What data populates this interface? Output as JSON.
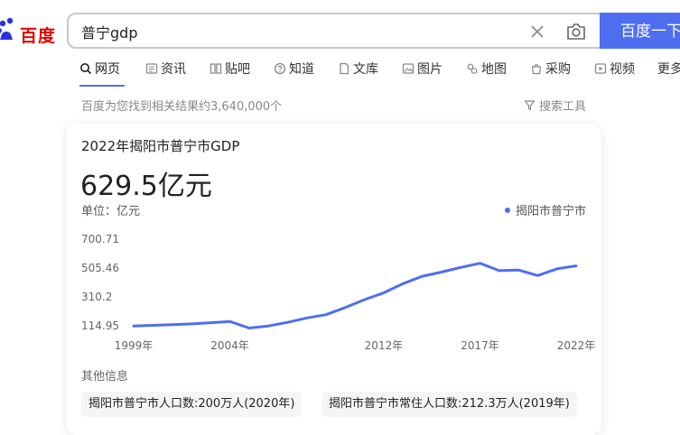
{
  "logo": {
    "text": "百度"
  },
  "search": {
    "query": "普宁gdp",
    "button_label": "百度一下"
  },
  "tabs": [
    {
      "label": "网页",
      "icon": "search-icon",
      "active": true
    },
    {
      "label": "资讯",
      "icon": "news-icon"
    },
    {
      "label": "贴吧",
      "icon": "tieba-icon"
    },
    {
      "label": "知道",
      "icon": "question-icon"
    },
    {
      "label": "文库",
      "icon": "document-icon"
    },
    {
      "label": "图片",
      "icon": "image-icon"
    },
    {
      "label": "地图",
      "icon": "map-icon"
    },
    {
      "label": "采购",
      "icon": "purchase-icon"
    },
    {
      "label": "视频",
      "icon": "video-icon"
    },
    {
      "label": "更多",
      "icon": ""
    }
  ],
  "result_count": "百度为您找到相关结果约3,640,000个",
  "tools_label": "搜索工具",
  "card": {
    "title": "2022年揭阳市普宁市GDP",
    "value": "629.5亿元",
    "unit": "单位：亿元",
    "other_label": "其他信息",
    "chips": [
      "揭阳市普宁市人口数:200万人(2020年)",
      "揭阳市普宁市常住人口数:212.3万人(2019年)"
    ]
  },
  "chart_data": {
    "type": "line",
    "series": [
      {
        "name": "揭阳市普宁市",
        "color": "#4e6ef2",
        "x": [
          1999,
          2000,
          2001,
          2002,
          2003,
          2004,
          2005,
          2006,
          2007,
          2008,
          2009,
          2010,
          2011,
          2012,
          2013,
          2014,
          2015,
          2016,
          2017,
          2018,
          2019,
          2020,
          2021,
          2022
        ],
        "values": [
          114,
          118,
          122,
          128,
          136,
          144,
          100,
          114,
          138,
          168,
          190,
          238,
          292,
          338,
          400,
          450,
          478,
          510,
          538,
          488,
          492,
          455,
          500,
          520
        ]
      }
    ],
    "y_ticks": [
      "700.71",
      "505.46",
      "310.2",
      "114.95"
    ],
    "x_ticks": [
      "1999年",
      "2004年",
      "2012年",
      "2017年",
      "2022年"
    ],
    "ylim": [
      114.95,
      700.71
    ],
    "legend_position": "top-right",
    "grid": false
  }
}
